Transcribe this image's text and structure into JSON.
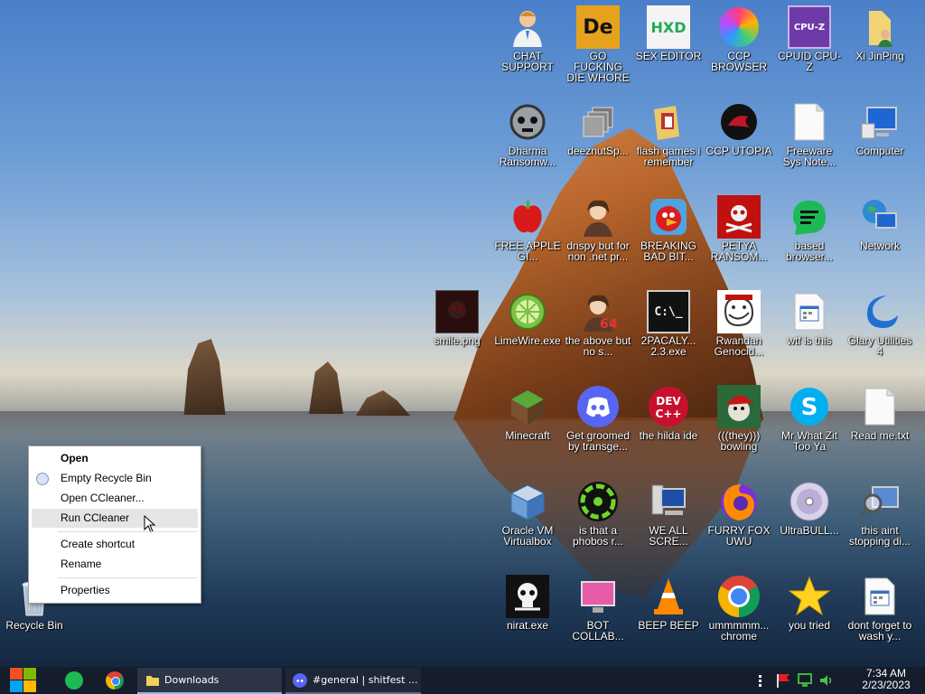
{
  "desktop": {
    "icons": [
      {
        "label": "CHAT SUPPORT",
        "icon": "doctor-icon"
      },
      {
        "label": "GO FUCKING DIE WHORE",
        "icon": "de-app-icon"
      },
      {
        "label": "SEX EDITOR",
        "icon": "hxd-icon"
      },
      {
        "label": "CCP BROWSER",
        "icon": "colorful-browser-icon"
      },
      {
        "label": "CPUID CPU-Z",
        "icon": "cpu-z-icon"
      },
      {
        "label": "Xi JinPing",
        "icon": "folder-user-icon"
      },
      {
        "label": "Dharma Ransomw...",
        "icon": "skull-mask-icon"
      },
      {
        "label": "deeznutSp...",
        "icon": "stack-icon"
      },
      {
        "label": "flash games i remember",
        "icon": "folder-icon"
      },
      {
        "label": "CCP UTOPIA",
        "icon": "red-dragon-icon"
      },
      {
        "label": "Freeware Sys Note...",
        "icon": "blank-file-icon"
      },
      {
        "label": "Computer",
        "icon": "computer-icon"
      },
      {
        "label": "FREE APPLE GI...",
        "icon": "apple-icon"
      },
      {
        "label": "dnspy but for non .net pr...",
        "icon": "portrait-icon"
      },
      {
        "label": "BREAKING BAD BIT...",
        "icon": "angry-bird-icon"
      },
      {
        "label": "PETYA RANSOM...",
        "icon": "skull-crossbones-icon"
      },
      {
        "label": "based browser...",
        "icon": "chat-bubble-icon"
      },
      {
        "label": "Network",
        "icon": "network-icon"
      },
      {
        "label": "smile.png",
        "icon": "image-icon"
      },
      {
        "label": "LimeWire.exe",
        "icon": "limewire-icon"
      },
      {
        "label": "the above but no s...",
        "icon": "portrait-64-icon"
      },
      {
        "label": "2PACALY... 2.3.exe",
        "icon": "terminal-icon"
      },
      {
        "label": "Rwandan Genocid...",
        "icon": "troll-face-icon"
      },
      {
        "label": "wtf is this",
        "icon": "window-file-icon"
      },
      {
        "label": "Glary Utilities 4",
        "icon": "glary-icon"
      },
      {
        "label": "Minecraft",
        "icon": "minecraft-icon"
      },
      {
        "label": "Get groomed by transge...",
        "icon": "discord-icon"
      },
      {
        "label": "the hilda ide",
        "icon": "devcpp-icon"
      },
      {
        "label": "(((they))) bowling",
        "icon": "elf-icon"
      },
      {
        "label": "Mr What Zit Too Ya",
        "icon": "skype-icon"
      },
      {
        "label": "Read me.txt",
        "icon": "text-file-icon"
      },
      {
        "label": "Recycle Bin",
        "icon": "recycle-bin-icon"
      },
      {
        "label": "Oracle VM Virtualbox",
        "icon": "virtualbox-icon"
      },
      {
        "label": "is that a phobos r...",
        "icon": "green-circle-icon"
      },
      {
        "label": "WE ALL SCRE...",
        "icon": "computer-alt-icon"
      },
      {
        "label": "FURRY FOX UWU",
        "icon": "firefox-icon"
      },
      {
        "label": "UltraBULL...",
        "icon": "disc-icon"
      },
      {
        "label": "this aint stopping di...",
        "icon": "magnifier-computer-icon"
      },
      {
        "label": "nirat.exe",
        "icon": "skull-icon"
      },
      {
        "label": "BOT COLLAB...",
        "icon": "monitor-pink-icon"
      },
      {
        "label": "BEEP BEEP",
        "icon": "vlc-icon"
      },
      {
        "label": "ummmmm... chrome",
        "icon": "chrome-icon"
      },
      {
        "label": "you tried",
        "icon": "star-icon"
      },
      {
        "label": "dont forget to wash y...",
        "icon": "window-file-icon"
      }
    ]
  },
  "context_menu": {
    "open": "Open",
    "empty_recycle_bin": "Empty Recycle Bin",
    "open_ccleaner": "Open CCleaner...",
    "run_ccleaner": "Run CCleaner",
    "create_shortcut": "Create shortcut",
    "rename": "Rename",
    "properties": "Properties"
  },
  "taskbar": {
    "tasks": [
      {
        "label": "Downloads",
        "icon": "folder-icon"
      },
      {
        "label": "#general | shitfest ...",
        "icon": "discord-icon"
      }
    ],
    "time": "7:34 AM",
    "date": "2/23/2023"
  },
  "colors": {
    "taskbar": "#151c2c",
    "discord": "#5865f2",
    "accent": "#8fb4e8"
  }
}
